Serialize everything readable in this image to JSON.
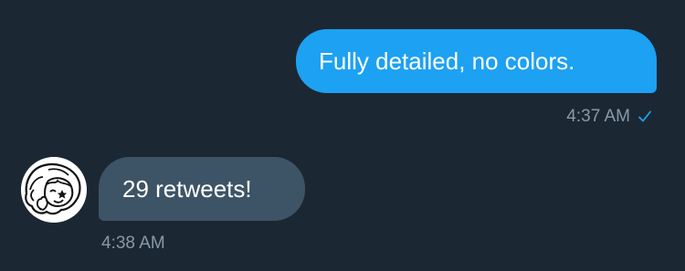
{
  "messages": [
    {
      "direction": "sent",
      "text": "Fully detailed, no colors.",
      "time": "4:37 AM",
      "status_icon": "checkmark-icon"
    },
    {
      "direction": "received",
      "text": "29 retweets!",
      "time": "4:38 AM",
      "avatar_icon": "cartoon-avatar"
    }
  ],
  "colors": {
    "background": "#1c2734",
    "sent_bubble": "#1da1f2",
    "received_bubble": "#3d5466",
    "timestamp": "#8899a6",
    "read_check": "#1da1f2"
  }
}
